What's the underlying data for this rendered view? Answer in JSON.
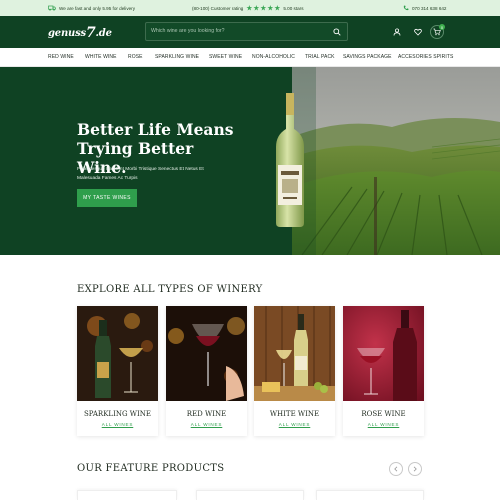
{
  "topbar": {
    "delivery_text": "We are fast and only 5.95 for delivery",
    "rating_text": "(80-100) Customer rating",
    "stars_text": "5.00 stars",
    "stars_count": 5,
    "phone": "070 314 638 642"
  },
  "header": {
    "logo_prefix": "genuss",
    "logo_seven": "7",
    "logo_suffix": ".de",
    "search_placeholder": "Which wine are you looking for?",
    "cart_count": "0"
  },
  "nav": {
    "items": [
      "RED WINE",
      "WHITE WINE",
      "ROSE",
      "SPARKLING WINE",
      "SWEET WINE",
      "NON-ALCOHOLIC",
      "TRIAL PACK",
      "SAVINGS PACKAGE",
      "ACCESORIES SPIRITS"
    ]
  },
  "hero": {
    "title": "Better Life Means Trying Better Wine.",
    "subtitle": "Pellentesque Habitant Morbi Tristique Senectus Et Netus Et Malesuada Fames Ac Turpis",
    "button_label": "MY TASTE WINES"
  },
  "types_section": {
    "title": "EXPLORE ALL TYPES OF WINERY",
    "cards": [
      {
        "name": "SPARKLING WINE",
        "link": "ALL WINES"
      },
      {
        "name": "RED WINE",
        "link": "ALL WINES"
      },
      {
        "name": "WHITE WINE",
        "link": "ALL WINES"
      },
      {
        "name": "ROSE WINE",
        "link": "ALL WINES"
      }
    ]
  },
  "featured_section": {
    "title": "OUR FEATURE PRODUCTS"
  },
  "colors": {
    "brand_green": "#0f4223",
    "accent_green": "#2f9e4c",
    "topbar_bg": "#dff2df"
  },
  "icons": [
    "truck-icon",
    "star-icon",
    "phone-icon",
    "search-icon",
    "user-icon",
    "heart-icon",
    "cart-icon",
    "chevron-left-icon",
    "chevron-right-icon"
  ]
}
